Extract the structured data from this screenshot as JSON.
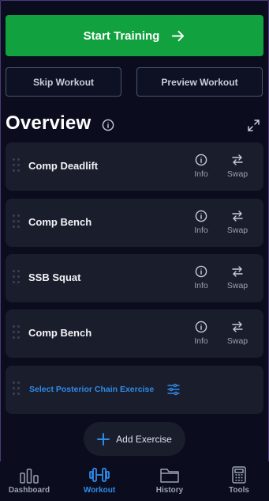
{
  "header": {
    "start_label": "Start Training",
    "skip_label": "Skip Workout",
    "preview_label": "Preview Workout"
  },
  "overview": {
    "title": "Overview",
    "exercises": [
      {
        "name": "Comp Deadlift",
        "info_label": "Info",
        "swap_label": "Swap"
      },
      {
        "name": "Comp Bench",
        "info_label": "Info",
        "swap_label": "Swap"
      },
      {
        "name": "SSB Squat",
        "info_label": "Info",
        "swap_label": "Swap"
      },
      {
        "name": "Comp Bench",
        "info_label": "Info",
        "swap_label": "Swap"
      }
    ],
    "select_label": "Select Posterior Chain Exercise",
    "add_label": "Add Exercise"
  },
  "nav": {
    "items": [
      {
        "label": "Dashboard",
        "icon": "bar-chart-icon"
      },
      {
        "label": "Workout",
        "icon": "dumbbell-icon"
      },
      {
        "label": "History",
        "icon": "folder-icon"
      },
      {
        "label": "Tools",
        "icon": "calculator-icon"
      }
    ],
    "active": "Workout"
  },
  "colors": {
    "background": "#0b0d1f",
    "card": "#1a1d2c",
    "primary_green": "#12a13f",
    "accent_blue": "#2f8be8",
    "muted_text": "#9aa1ae"
  }
}
